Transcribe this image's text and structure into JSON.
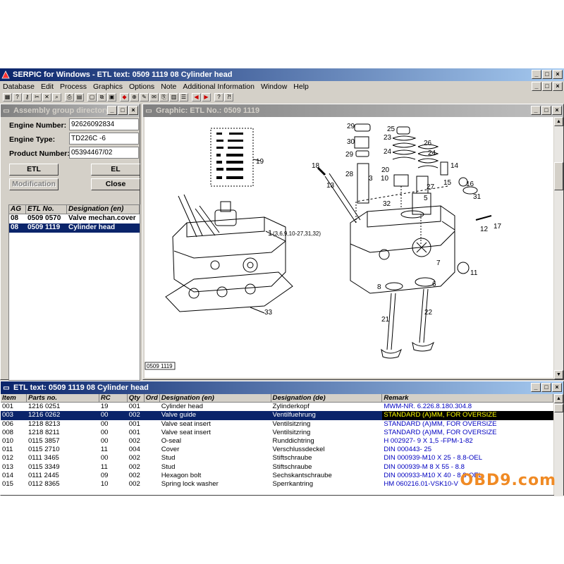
{
  "app": {
    "title": "SERPIC for Windows - ETL text: 0509 1119   08  Cylinder head",
    "menu": [
      "Database",
      "Edit",
      "Process",
      "Graphics",
      "Options",
      "Note",
      "Additional Information",
      "Window",
      "Help"
    ]
  },
  "assembly": {
    "title": "Assembly group directory",
    "engine_number_label": "Engine Number:",
    "engine_number": "92626092834",
    "engine_type_label": "Engine Type:",
    "engine_type": "TD226C -6",
    "product_number_label": "Product Number:",
    "product_number": "05394467/02",
    "btn_etl": "ETL",
    "btn_el": "EL",
    "btn_modification": "Modification",
    "btn_close": "Close",
    "columns": [
      "AG",
      "ETL No.",
      "Designation (en)"
    ],
    "rows": [
      {
        "ag": "08",
        "etl": "0509 0570",
        "designation": "Valve mechan.cover"
      },
      {
        "ag": "08",
        "etl": "0509 1119",
        "designation": "Cylinder head"
      }
    ]
  },
  "graphic": {
    "title": "Graphic: ETL No.: 0509 1119",
    "drawing_ref": "0509 1119",
    "callouts": [
      "29",
      "30",
      "29",
      "28",
      "18",
      "13",
      "19",
      "25",
      "23",
      "24",
      "26",
      "24",
      "20",
      "10",
      "3",
      "27",
      "14",
      "15",
      "16",
      "31",
      "32",
      "5",
      "1",
      "(3,6,9,10-27,31,32)",
      "12",
      "17",
      "11",
      "8",
      "6",
      "7",
      "21",
      "22",
      "33"
    ]
  },
  "etl": {
    "title": "ETL text: 0509 1119   08  Cylinder head",
    "columns": [
      "Item",
      "Parts no.",
      "RC",
      "Qty",
      "Ord",
      "Designation (en)",
      "Designation (de)",
      "Remark"
    ],
    "rows": [
      {
        "item": "001",
        "parts": "1216 0251",
        "rc": "19",
        "qty": "001",
        "ord": "",
        "en": "Cylinder head",
        "de": "Zylinderkopf",
        "remark": "MWM-NR. 6.226.8.180.304.8"
      },
      {
        "item": "003",
        "parts": "1216 0262",
        "rc": "00",
        "qty": "002",
        "ord": "",
        "en": "Valve guide",
        "de": "Ventilfuehrung",
        "remark": "STANDARD (A)MM, FOR OVERSIZE"
      },
      {
        "item": "006",
        "parts": "1218 8213",
        "rc": "00",
        "qty": "001",
        "ord": "",
        "en": "Valve seat insert",
        "de": "Ventilsitzring",
        "remark": "STANDARD (A)MM, FOR OVERSIZE"
      },
      {
        "item": "008",
        "parts": "1218 8211",
        "rc": "00",
        "qty": "001",
        "ord": "",
        "en": "Valve seat insert",
        "de": "Ventilsitzring",
        "remark": "STANDARD (A)MM, FOR OVERSIZE"
      },
      {
        "item": "010",
        "parts": "0115 3857",
        "rc": "00",
        "qty": "002",
        "ord": "",
        "en": "O-seal",
        "de": "Runddichtring",
        "remark": "H 002927- 9 X 1,5 -FPM-1-82"
      },
      {
        "item": "011",
        "parts": "0115 2710",
        "rc": "11",
        "qty": "004",
        "ord": "",
        "en": "Cover",
        "de": "Verschlussdeckel",
        "remark": "DIN 000443- 25"
      },
      {
        "item": "012",
        "parts": "0111 3465",
        "rc": "00",
        "qty": "002",
        "ord": "",
        "en": "Stud",
        "de": "Stiftschraube",
        "remark": "DIN 000939-M10 X 25 - 8.8-OEL"
      },
      {
        "item": "013",
        "parts": "0115 3349",
        "rc": "11",
        "qty": "002",
        "ord": "",
        "en": "Stud",
        "de": "Stiftschraube",
        "remark": "DIN 000939-M 8 X 55 - 8.8"
      },
      {
        "item": "014",
        "parts": "0111 2445",
        "rc": "09",
        "qty": "002",
        "ord": "",
        "en": "Hexagon bolt",
        "de": "Sechskantschraube",
        "remark": "DIN 000933-M10 X 40 - 8.8-OEL"
      },
      {
        "item": "015",
        "parts": "0112 8365",
        "rc": "10",
        "qty": "002",
        "ord": "",
        "en": "Spring lock washer",
        "de": "Sperrkantring",
        "remark": "HM 060216.01-VSK10-V"
      }
    ]
  },
  "watermark": "OBD9.com"
}
